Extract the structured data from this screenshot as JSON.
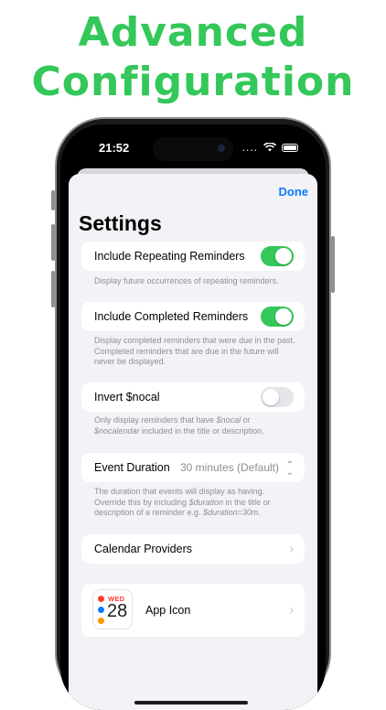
{
  "headline": {
    "line1": "Advanced",
    "line2": "Configuration"
  },
  "status_bar": {
    "time": "21:52",
    "signal": "....",
    "wifi_icon": "wifi-icon",
    "battery_icon": "battery-icon"
  },
  "nav": {
    "done_label": "Done"
  },
  "page": {
    "title": "Settings"
  },
  "settings": {
    "repeating": {
      "label": "Include Repeating Reminders",
      "enabled": true,
      "footnote": "Display future occurrences of repeating reminders."
    },
    "completed": {
      "label": "Include Completed Reminders",
      "enabled": true,
      "footnote": "Display completed reminders that were due in the past. Completed reminders that are due in the future will never be displayed."
    },
    "invert": {
      "label": "Invert $nocal",
      "enabled": false,
      "footnote_parts": {
        "a": "Only display reminders that have ",
        "b": "$nocal",
        "c": " or ",
        "d": "$nocalendar",
        "e": " included in the title or description."
      }
    },
    "event_duration": {
      "label": "Event Duration",
      "value": "30 minutes (Default)",
      "footnote_parts": {
        "a": "The duration that events will display as having. Override this by including ",
        "b": "$duration",
        "c": " in the title or description of a reminder e.g. ",
        "d": "$duration=30m",
        "e": "."
      }
    },
    "calendar_providers": {
      "label": "Calendar Providers"
    },
    "app_icon": {
      "label": "App Icon",
      "weekday": "WED",
      "day": "28"
    }
  },
  "colors": {
    "accent": "#0a7aff",
    "toggle_on": "#34c759",
    "headline": "#34c759"
  }
}
